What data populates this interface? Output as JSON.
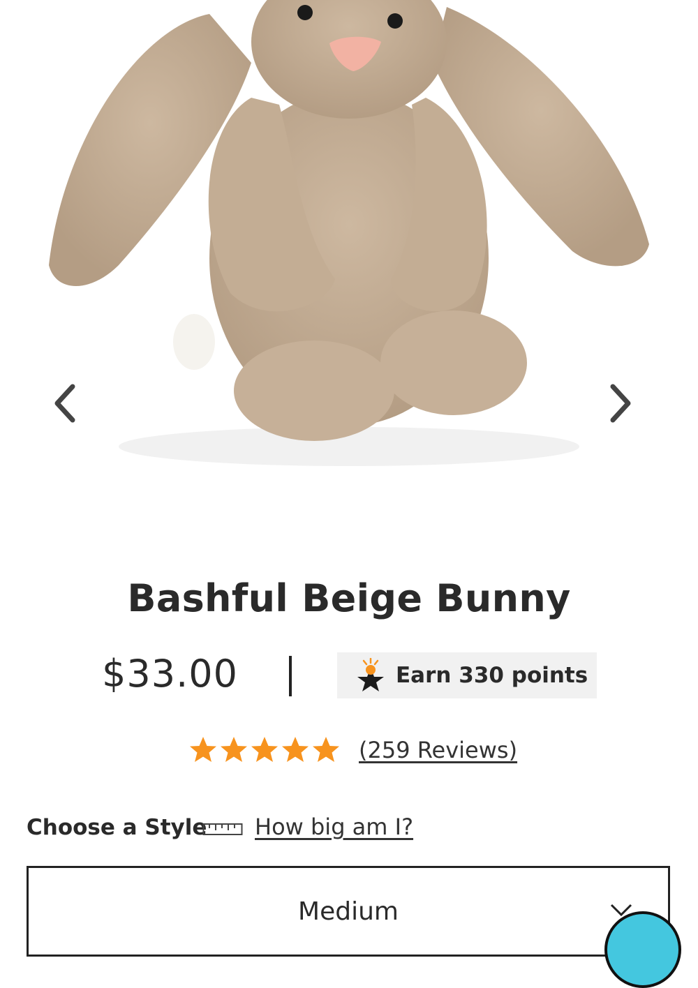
{
  "product": {
    "title": "Bashful Beige Bunny",
    "price": "$33.00",
    "price_separator": "|",
    "points_text": "Earn 330 points",
    "reviews_text": "(259 Reviews)",
    "rating_stars": 5,
    "star_color": "#f7931e"
  },
  "gallery": {
    "image_subject": "beige bunny plush toy",
    "prev_icon": "chevron-left-icon",
    "next_icon": "chevron-right-icon"
  },
  "style_selector": {
    "label": "Choose a Style",
    "size_link": "How big am I?",
    "selected_value": "Medium"
  },
  "colors": {
    "text": "#2a2a2a",
    "badge_background": "#f1f1f1",
    "chat_bubble": "#44c7df"
  }
}
